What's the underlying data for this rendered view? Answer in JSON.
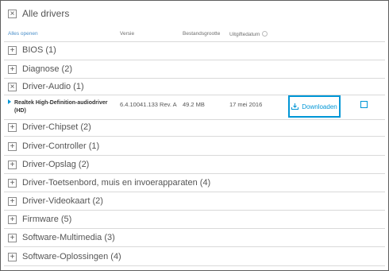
{
  "header": {
    "title": "Alle drivers",
    "toggle_symbol": "×"
  },
  "columns": {
    "open_all": "Alles openen",
    "version": "Versie",
    "file_size": "Bestandsgrootte",
    "release_date": "Uitgiftedatum"
  },
  "categories": [
    {
      "label": "BIOS (1)",
      "symbol": "+"
    },
    {
      "label": "Diagnose (2)",
      "symbol": "+"
    },
    {
      "label": "Driver-Audio (1)",
      "symbol": "×"
    },
    {
      "label": "Driver-Chipset (2)",
      "symbol": "+"
    },
    {
      "label": "Driver-Controller (1)",
      "symbol": "+"
    },
    {
      "label": "Driver-Opslag (2)",
      "symbol": "+"
    },
    {
      "label": "Driver-Toetsenbord, muis en invoerapparaten (4)",
      "symbol": "+"
    },
    {
      "label": "Driver-Videokaart (2)",
      "symbol": "+"
    },
    {
      "label": "Firmware (5)",
      "symbol": "+"
    },
    {
      "label": "Software-Multimedia (3)",
      "symbol": "+"
    },
    {
      "label": "Software-Oplossingen (4)",
      "symbol": "+"
    }
  ],
  "driver": {
    "name": "Realtek High-Definition-audiodriver (HD)",
    "version": "6.4.10041.133 Rev. A",
    "size": "49.2 MB",
    "date": "17 mei 2016",
    "download_label": "Downloaden"
  },
  "colors": {
    "accent": "#0096d6",
    "border": "#5f5f5f",
    "text": "#555555"
  },
  "icons": {
    "download": "download-icon",
    "collapse": "close-icon",
    "expand": "plus-icon",
    "sort": "sort-icon",
    "caret": "caret-right-icon"
  }
}
